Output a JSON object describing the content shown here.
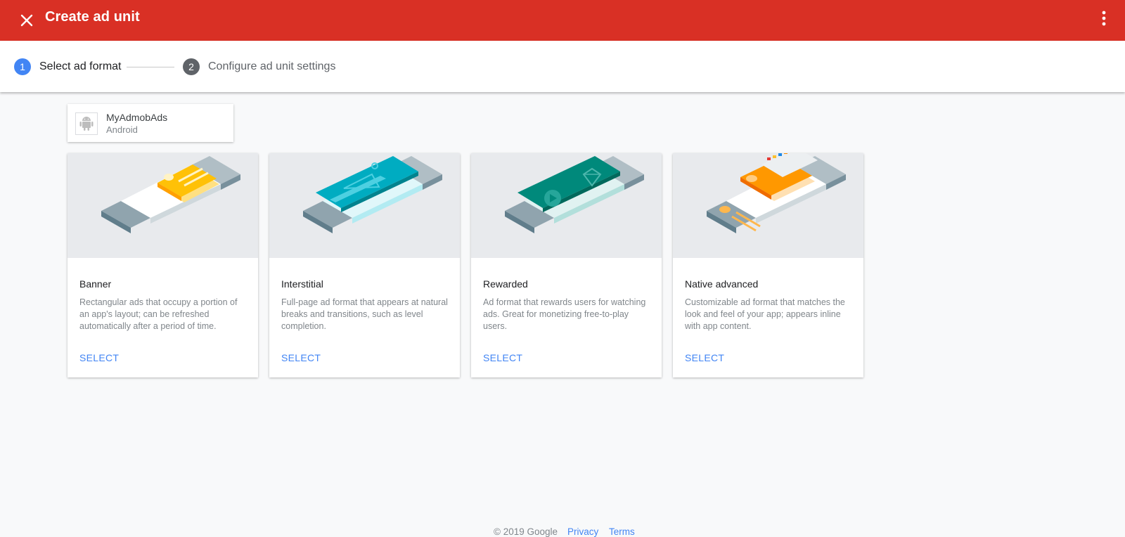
{
  "colors": {
    "topbar_bg": "#d93025",
    "step_active": "#4285f4",
    "step_inactive": "#5f6368",
    "link": "#4285f4"
  },
  "topbar": {
    "close_icon": "close-icon",
    "title": "Create ad unit",
    "more_icon": "more-vert-icon"
  },
  "stepper": {
    "steps": [
      {
        "number": "1",
        "label": "Select ad format",
        "active": true
      },
      {
        "number": "2",
        "label": "Configure ad unit settings",
        "active": false
      }
    ]
  },
  "app": {
    "icon": "android-icon",
    "name": "MyAdmobAds",
    "platform": "Android"
  },
  "formats": [
    {
      "title": "Banner",
      "description": "Rectangular ads that occupy a portion of an app's layout; can be refreshed automatically after a period of time.",
      "action": "SELECT",
      "illustration": "banner-illustration"
    },
    {
      "title": "Interstitial",
      "description": "Full-page ad format that appears at natural breaks and transitions, such as level completion.",
      "action": "SELECT",
      "illustration": "interstitial-illustration"
    },
    {
      "title": "Rewarded",
      "description": "Ad format that rewards users for watching ads. Great for monetizing free-to-play users.",
      "action": "SELECT",
      "illustration": "rewarded-illustration"
    },
    {
      "title": "Native advanced",
      "description": "Customizable ad format that matches the look and feel of your app; appears inline with app content.",
      "action": "SELECT",
      "illustration": "native-advanced-illustration"
    }
  ],
  "footer": {
    "copyright": "© 2019 Google",
    "privacy": "Privacy",
    "terms": "Terms"
  }
}
